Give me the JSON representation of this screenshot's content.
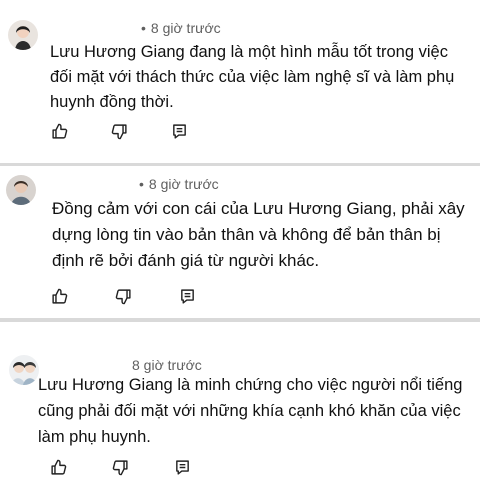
{
  "comments": [
    {
      "time": "8 giờ trước",
      "text": "Lưu Hương Giang đang là một hình mẫu tốt trong việc đối mặt với thách thức của việc làm nghệ sĩ và làm phụ huynh đồng thời.",
      "like_icon": "thumbs-up-icon",
      "dislike_icon": "thumbs-down-icon",
      "reply_icon": "reply-icon"
    },
    {
      "time": "8 giờ trước",
      "text": "Đồng cảm với con cái của Lưu Hương Giang, phải xây dựng lòng tin vào bản thân và không để bản thân bị định rẽ bởi đánh giá từ người khác.",
      "like_icon": "thumbs-up-icon",
      "dislike_icon": "thumbs-down-icon",
      "reply_icon": "reply-icon"
    },
    {
      "time": "8 giờ trước",
      "text": "Lưu Hương Giang là minh chứng cho việc người nổi tiếng cũng phải đối mặt với những khía cạnh khó khăn của việc làm phụ huynh.",
      "like_icon": "thumbs-up-icon",
      "dislike_icon": "thumbs-down-icon",
      "reply_icon": "reply-icon"
    }
  ],
  "colors": {
    "background": "#d9d9d9",
    "card": "#ffffff",
    "meta": "#5f5f5f",
    "text": "#111111"
  }
}
